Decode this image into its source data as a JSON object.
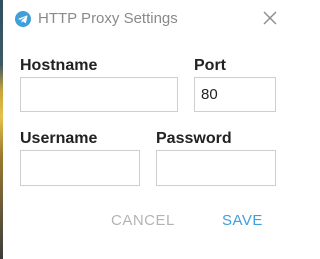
{
  "dialog": {
    "title": "HTTP Proxy Settings",
    "app_icon": "telegram-icon",
    "close_icon": "close-icon"
  },
  "form": {
    "hostname": {
      "label": "Hostname",
      "value": ""
    },
    "port": {
      "label": "Port",
      "value": "80"
    },
    "username": {
      "label": "Username",
      "value": ""
    },
    "password": {
      "label": "Password",
      "value": ""
    }
  },
  "buttons": {
    "cancel_label": "CANCEL",
    "save_label": "SAVE"
  },
  "colors": {
    "accent": "#3f9fdb",
    "title_text": "#8a8a8a",
    "label_text": "#222222",
    "disabled_button": "#b4b4b4",
    "field_border": "#cfcfcf"
  }
}
